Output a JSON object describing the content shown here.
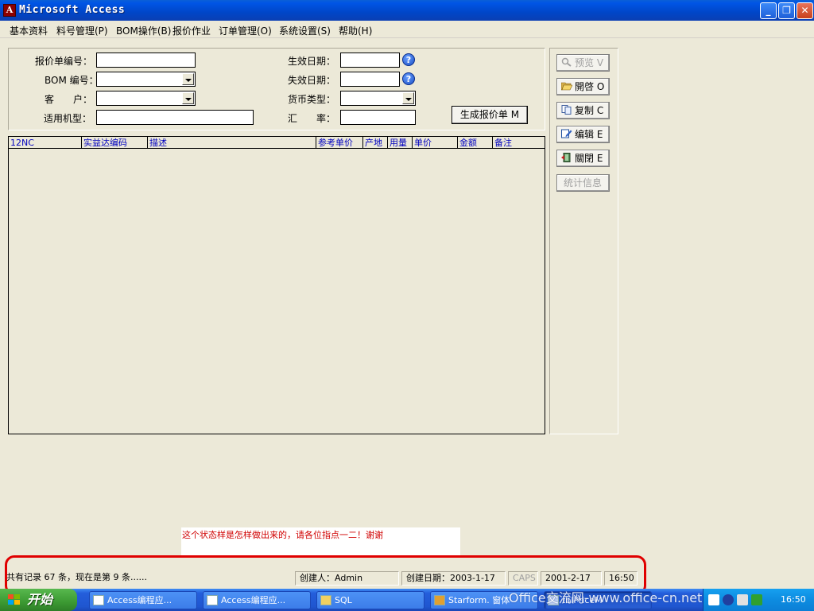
{
  "window": {
    "title": "Microsoft Access",
    "controls": {
      "minimize": "_",
      "restore": "❐",
      "close": "✕"
    }
  },
  "menu": [
    "基本资料",
    "料号管理(P)",
    "BOM操作(B)",
    "报价作业",
    "订单管理(O)",
    "系统设置(S)",
    "帮助(H)"
  ],
  "form": {
    "quote_no_label": "报价单编号：",
    "quote_no_value": "",
    "bom_no_label": "BOM 编号：",
    "bom_no_value": "",
    "customer_label": "客　　户：",
    "customer_value": "",
    "model_label": "适用机型：",
    "model_value": "",
    "effective_date_label": "生效日期：",
    "effective_date_value": "",
    "expire_date_label": "失效日期：",
    "expire_date_value": "",
    "currency_label": "货币类型：",
    "currency_value": "",
    "rate_label": "汇　　率：",
    "rate_value": "",
    "generate_button": "生成报价单 M",
    "help_glyph": "?"
  },
  "list": {
    "columns": [
      "12NC",
      "实益达编码",
      "描述",
      "参考单价",
      "产地",
      "用量",
      "单价",
      "金额",
      "备注"
    ]
  },
  "side_buttons": [
    {
      "label": "预览 V",
      "enabled": false,
      "icon": "magnifier-icon"
    },
    {
      "label": "開啓 O",
      "enabled": true,
      "icon": "open-folder-icon"
    },
    {
      "label": "复制 C",
      "enabled": true,
      "icon": "copy-icon"
    },
    {
      "label": "编辑 E",
      "enabled": true,
      "icon": "edit-icon"
    },
    {
      "label": "關閉 E",
      "enabled": true,
      "icon": "exit-door-icon"
    },
    {
      "label": "统计信息",
      "enabled": false,
      "icon": ""
    }
  ],
  "annotation": {
    "text": "这个状态样是怎样做出来的，请各位指点一二！谢谢",
    "color": "#d00000"
  },
  "statusbar": {
    "records": "共有记录 67 条，现在是第 9 条......",
    "creator": "创建人：Admin",
    "created_date": "创建日期：2003-1-17",
    "caps": "CAPS",
    "date": "2001-2-17",
    "time": "16:50"
  },
  "taskbar": {
    "start": "开始",
    "tasks": [
      {
        "label": "Access编程应...",
        "active": false
      },
      {
        "label": "Access编程应...",
        "active": false
      },
      {
        "label": "SQL",
        "active": false
      },
      {
        "label": "Starform. 窗体",
        "active": false
      },
      {
        "label": "tblPriceM",
        "active": true
      }
    ],
    "clock": "16:50"
  },
  "watermark": "Office交流网-www.office-cn.net"
}
